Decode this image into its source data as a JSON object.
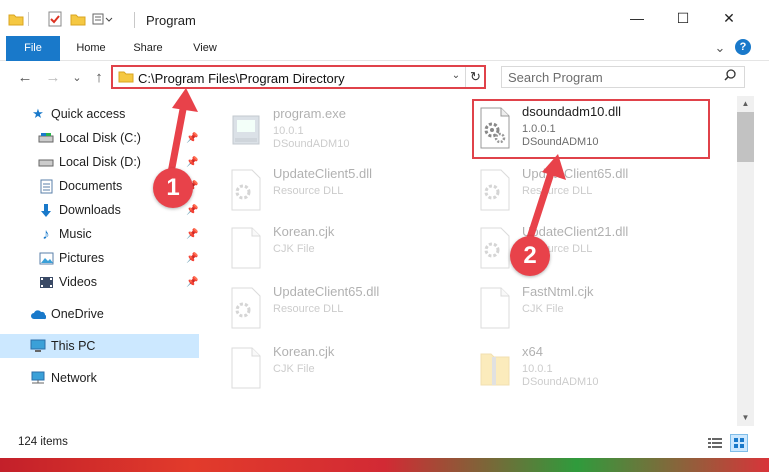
{
  "window": {
    "title": "Program",
    "controls": {
      "minimize": "—",
      "maximize": "☐",
      "close": "✕"
    }
  },
  "ribbon": {
    "tabs": [
      {
        "label": "File"
      },
      {
        "label": "Home"
      },
      {
        "label": "Share"
      },
      {
        "label": "View"
      }
    ],
    "expand": "⌄",
    "help": "?"
  },
  "navigation": {
    "back": "←",
    "forward": "→",
    "recent": "⌄",
    "up": "↑",
    "address": "C:\\Program Files\\Program Directory",
    "dropdown": "⌄",
    "refresh": "↻",
    "search_placeholder": "Search Program"
  },
  "sidebar": {
    "items": [
      {
        "label": "Quick access",
        "icon": "star-icon"
      },
      {
        "label": "Local Disk (C:)",
        "icon": "drive-icon",
        "pinned": true
      },
      {
        "label": "Local Disk (D:)",
        "icon": "drive-icon",
        "pinned": true
      },
      {
        "label": "Documents",
        "icon": "documents-icon",
        "pinned": true
      },
      {
        "label": "Downloads",
        "icon": "downloads-icon",
        "pinned": true
      },
      {
        "label": "Music",
        "icon": "music-icon",
        "pinned": true
      },
      {
        "label": "Pictures",
        "icon": "pictures-icon",
        "pinned": true
      },
      {
        "label": "Videos",
        "icon": "videos-icon",
        "pinned": true
      },
      {
        "label": "OneDrive",
        "icon": "onedrive-icon"
      },
      {
        "label": "This PC",
        "icon": "computer-icon",
        "selected": true
      },
      {
        "label": "Network",
        "icon": "network-icon"
      }
    ]
  },
  "files": [
    {
      "name": "program.exe",
      "line2": "10.0.1",
      "line3": "DSoundADM10",
      "icon": "exe-icon"
    },
    {
      "name": "dsoundadm10.dll",
      "line2": "1.0.0.1",
      "line3": "DSoundADM10",
      "icon": "dll-gear-icon",
      "highlighted": true
    },
    {
      "name": "UpdateClient5.dll",
      "line2": "Resource DLL",
      "line3": "",
      "icon": "dll-gear-icon"
    },
    {
      "name": "UpdateClient65.dll",
      "line2": "Resource DLL",
      "line3": "",
      "icon": "dll-gear-icon"
    },
    {
      "name": "Korean.cjk",
      "line2": "CJK File",
      "line3": "",
      "icon": "file-icon"
    },
    {
      "name": "UpdateClient21.dll",
      "line2": "Resource DLL",
      "line3": "",
      "icon": "dll-gear-icon"
    },
    {
      "name": "UpdateClient65.dll",
      "line2": "Resource DLL",
      "line3": "",
      "icon": "dll-gear-icon"
    },
    {
      "name": "FastNtml.cjk",
      "line2": "CJK File",
      "line3": "",
      "icon": "file-icon"
    },
    {
      "name": "Korean.cjk",
      "line2": "CJK File",
      "line3": "",
      "icon": "file-icon"
    },
    {
      "name": "x64",
      "line2": "10.0.1",
      "line3": "DSoundADM10",
      "icon": "zip-folder-icon"
    }
  ],
  "status": {
    "items_count": "124 items"
  },
  "annotations": {
    "marker1": "1",
    "marker2": "2"
  },
  "colors": {
    "accent": "#1979ca",
    "highlight": "#e0424a",
    "selected": "#cce8ff"
  }
}
